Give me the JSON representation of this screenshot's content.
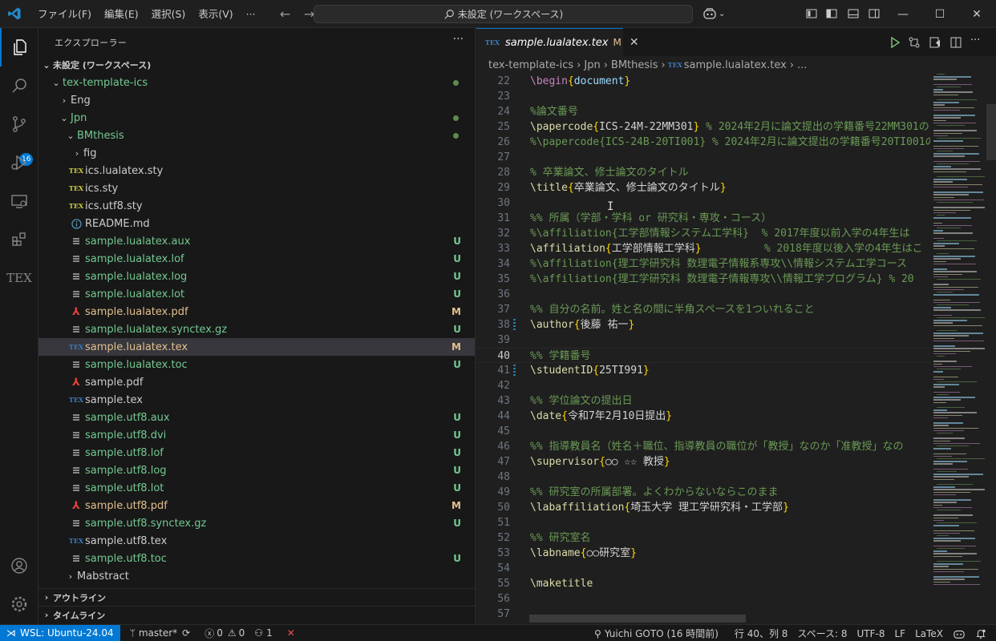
{
  "titlebar": {
    "menus": [
      "ファイル(F)",
      "編集(E)",
      "選択(S)",
      "表示(V)",
      "···"
    ],
    "search_text": "未設定 (ワークスペース)"
  },
  "activity_bar": {
    "scm_badge": "16",
    "tex_label": "TEX"
  },
  "sidebar": {
    "title": "エクスプローラー",
    "more": "···",
    "workspace_label": "未設定 (ワークスペース)",
    "rows": [
      {
        "label": "tex-template-ics",
        "status": "",
        "dot": true,
        "color": "green"
      },
      {
        "label": "Eng",
        "status": "",
        "color": "plain"
      },
      {
        "label": "Jpn",
        "status": "",
        "dot": true,
        "color": "green"
      },
      {
        "label": "BMthesis",
        "status": "",
        "dot": true,
        "color": "green"
      },
      {
        "label": "fig",
        "status": "",
        "color": "plain"
      },
      {
        "label": "ics.lualatex.sty",
        "status": "",
        "color": "plain"
      },
      {
        "label": "ics.sty",
        "status": "",
        "color": "plain"
      },
      {
        "label": "ics.utf8.sty",
        "status": "",
        "color": "plain"
      },
      {
        "label": "README.md",
        "status": "",
        "color": "plain"
      },
      {
        "label": "sample.lualatex.aux",
        "status": "U",
        "color": "green"
      },
      {
        "label": "sample.lualatex.lof",
        "status": "U",
        "color": "green"
      },
      {
        "label": "sample.lualatex.log",
        "status": "U",
        "color": "green"
      },
      {
        "label": "sample.lualatex.lot",
        "status": "U",
        "color": "green"
      },
      {
        "label": "sample.lualatex.pdf",
        "status": "M",
        "color": "mod"
      },
      {
        "label": "sample.lualatex.synctex.gz",
        "status": "U",
        "color": "green"
      },
      {
        "label": "sample.lualatex.tex",
        "status": "M",
        "color": "mod"
      },
      {
        "label": "sample.lualatex.toc",
        "status": "U",
        "color": "green"
      },
      {
        "label": "sample.pdf",
        "status": "",
        "color": "plain"
      },
      {
        "label": "sample.tex",
        "status": "",
        "color": "plain"
      },
      {
        "label": "sample.utf8.aux",
        "status": "U",
        "color": "green"
      },
      {
        "label": "sample.utf8.dvi",
        "status": "U",
        "color": "green"
      },
      {
        "label": "sample.utf8.lof",
        "status": "U",
        "color": "green"
      },
      {
        "label": "sample.utf8.log",
        "status": "U",
        "color": "green"
      },
      {
        "label": "sample.utf8.lot",
        "status": "U",
        "color": "green"
      },
      {
        "label": "sample.utf8.pdf",
        "status": "M",
        "color": "mod"
      },
      {
        "label": "sample.utf8.synctex.gz",
        "status": "U",
        "color": "green"
      },
      {
        "label": "sample.utf8.tex",
        "status": "",
        "color": "plain"
      },
      {
        "label": "sample.utf8.toc",
        "status": "U",
        "color": "green"
      },
      {
        "label": "Mabstract",
        "status": "",
        "color": "plain"
      }
    ],
    "outline_label": "アウトライン",
    "timeline_label": "タイムライン"
  },
  "editor": {
    "tab_label": "sample.lualatex.tex",
    "tab_status": "M",
    "breadcrumbs": [
      "tex-template-ics",
      "Jpn",
      "BMthesis",
      "sample.lualatex.tex",
      "..."
    ],
    "lines": [
      {
        "n": "22",
        "text": "\\begin{document}"
      },
      {
        "n": "23",
        "text": ""
      },
      {
        "n": "24",
        "text": "%論文番号"
      },
      {
        "n": "25",
        "text": "\\papercode{ICS-24M-22MM301} % 2024年2月に論文提出の学籍番号22MM301の"
      },
      {
        "n": "26",
        "text": "%\\papercode{ICS-24B-20TI001} % 2024年2月に論文提出の学籍番号20TI001の"
      },
      {
        "n": "27",
        "text": ""
      },
      {
        "n": "28",
        "text": "% 卒業論文、修士論文のタイトル"
      },
      {
        "n": "29",
        "text": "\\title{卒業論文、修士論文のタイトル}"
      },
      {
        "n": "30",
        "text": ""
      },
      {
        "n": "31",
        "text": "%% 所属（学部・学科 or 研究科・専攻・コース）"
      },
      {
        "n": "32",
        "text": "%\\affiliation{工学部情報システム工学科}  % 2017年度以前入学の4年生は"
      },
      {
        "n": "33",
        "text": "\\affiliation{工学部情報工学科}          % 2018年度以後入学の4年生はこ"
      },
      {
        "n": "34",
        "text": "%\\affiliation{理工学研究科 数理電子情報系専攻\\\\情報システム工学コース"
      },
      {
        "n": "35",
        "text": "%\\affiliation{理工学研究科 数理電子情報専攻\\\\情報工学プログラム} % 20"
      },
      {
        "n": "36",
        "text": ""
      },
      {
        "n": "37",
        "text": "%% 自分の名前。姓と名の間に半角スペースを1ついれること"
      },
      {
        "n": "38",
        "text": "\\author{後藤 祐一}"
      },
      {
        "n": "39",
        "text": ""
      },
      {
        "n": "40",
        "text": "%% 学籍番号"
      },
      {
        "n": "41",
        "text": "\\studentID{25TI991}"
      },
      {
        "n": "42",
        "text": ""
      },
      {
        "n": "43",
        "text": "%% 学位論文の提出日"
      },
      {
        "n": "44",
        "text": "\\date{令和7年2月10日提出}"
      },
      {
        "n": "45",
        "text": ""
      },
      {
        "n": "46",
        "text": "%% 指導教員名（姓名＋職位、指導教員の職位が「教授」なのか「准教授」なの"
      },
      {
        "n": "47",
        "text": "\\supervisor{○○ ☆☆ 教授}"
      },
      {
        "n": "48",
        "text": ""
      },
      {
        "n": "49",
        "text": "%% 研究室の所属部署。よくわからないならこのまま"
      },
      {
        "n": "50",
        "text": "\\labaffiliation{埼玉大学 理工学研究科・工学部}"
      },
      {
        "n": "51",
        "text": ""
      },
      {
        "n": "52",
        "text": "%% 研究室名"
      },
      {
        "n": "53",
        "text": "\\labname{○○研究室}"
      },
      {
        "n": "54",
        "text": ""
      },
      {
        "n": "55",
        "text": "\\maketitle"
      },
      {
        "n": "56",
        "text": ""
      },
      {
        "n": "57",
        "text": ""
      }
    ],
    "current_line": "40"
  },
  "statusbar": {
    "remote": "WSL: Ubuntu-24.04",
    "branch": "master*",
    "errors": "0",
    "warnings": "0",
    "ports": "1",
    "author": "Yuichi GOTO (16 時間前)",
    "position": "行 40、列 8",
    "spaces": "スペース: 8",
    "encoding": "UTF-8",
    "eol": "LF",
    "language": "LaTeX"
  },
  "colors": {
    "accent": "#0078d4",
    "untracked": "#73c991",
    "modified": "#e2c08d"
  }
}
